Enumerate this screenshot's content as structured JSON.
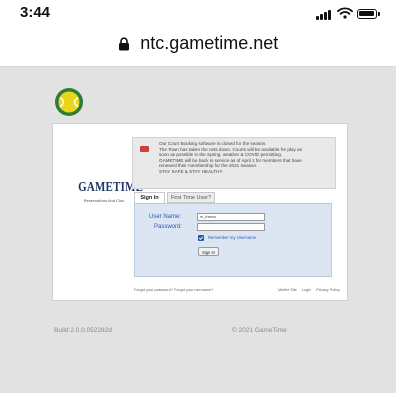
{
  "status_bar": {
    "time": "3:44"
  },
  "address_bar": {
    "url": "ntc.gametime.net"
  },
  "site": {
    "brand": "GAMETIME",
    "tagline": "Reservations And Club"
  },
  "notice": {
    "lines": [
      "Our Court Booking software is closed for the season.",
      "The Town has taken the nets down. Courts will be available for play as",
      "soon as possible in the Spring, weather & COVID permitting.",
      "GAMETIME will be back in service as of April 1 for members that have",
      "renewed their membership for the 2021 Season.",
      "STAY SAFE & STAY HEALTHY."
    ]
  },
  "tabs": {
    "sign_in": "Sign In",
    "first_time": "First Time User?"
  },
  "form": {
    "username_label": "User Name:",
    "username_value": "m_franco",
    "password_label": "Password:",
    "password_value": "",
    "remember_label": "Remember my Username",
    "remember_checked": true,
    "sign_in_button": "Sign In"
  },
  "footer": {
    "forgot_links": "Forgot your password?  Forgot your username?",
    "mobile_site": "Mobile Site",
    "login": "Login",
    "privacy_policy": "Privacy Policy",
    "build": "Build 2.0.0.052282d",
    "copyright": "© 2021 GameTime"
  },
  "colors": {
    "page_bg": "#e2e2e2",
    "link_blue": "#2a5aa8",
    "brand_navy": "#1d3561",
    "alert_red": "#d23c3c",
    "logo_green": "#2f7d32",
    "logo_yellow": "#e8d51c"
  },
  "icons": [
    "lock-icon",
    "cellular-signal-icon",
    "wifi-icon",
    "battery-icon",
    "tennis-ball-logo-icon",
    "warning-icon",
    "checkbox-checked-icon"
  ]
}
